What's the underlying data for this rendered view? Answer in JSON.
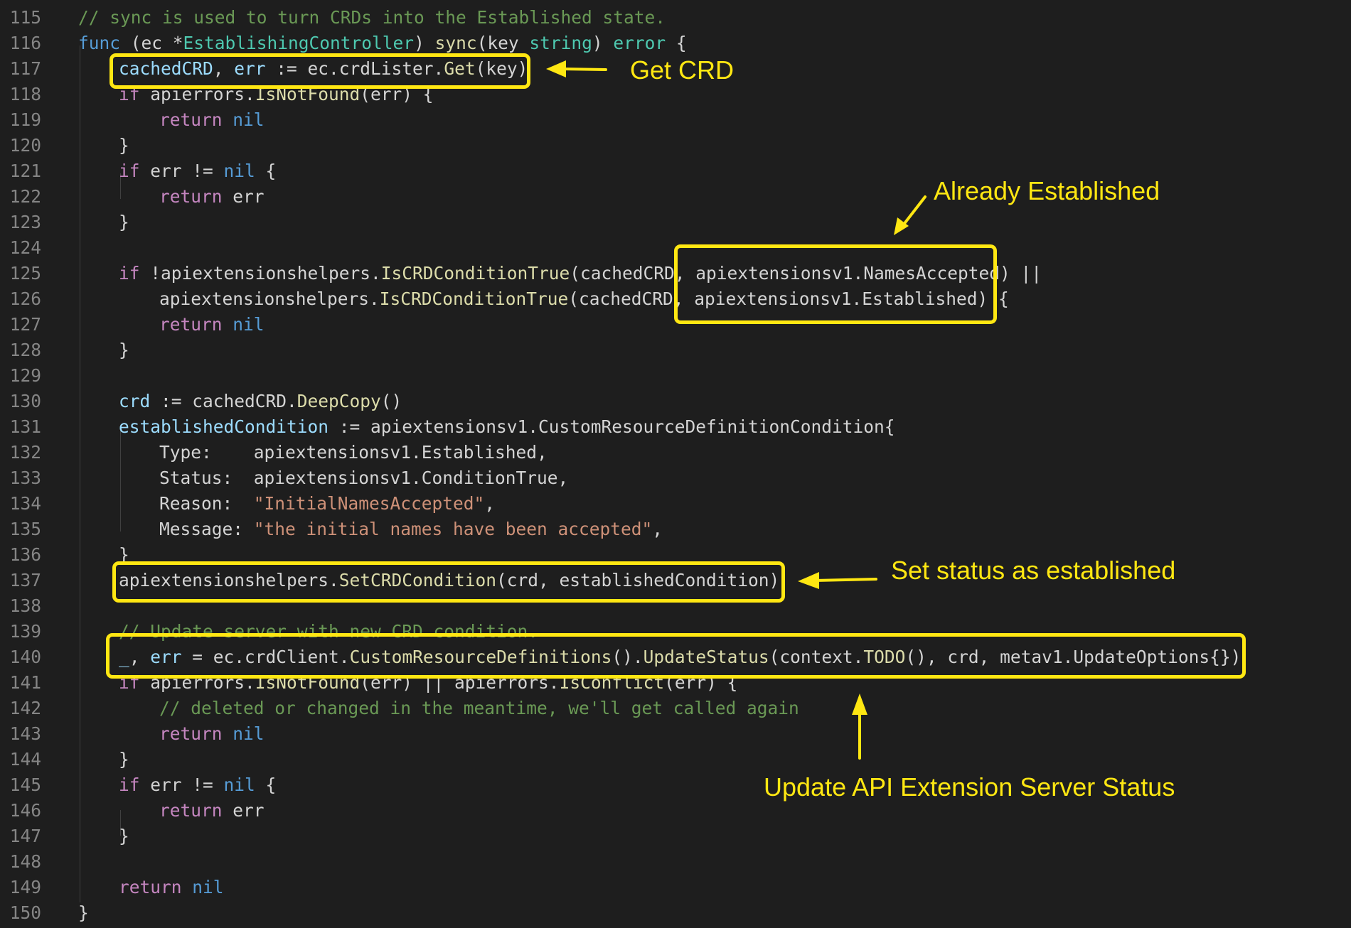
{
  "colors": {
    "background": "#1e1e1e",
    "line_number": "#858585",
    "highlight": "#ffe712",
    "comment": "#6a9955",
    "keyword": "#569cd6",
    "control": "#c586c0",
    "variable": "#9cdcfe",
    "function": "#dcdcaa",
    "type": "#4ec9b0",
    "string": "#ce9178",
    "text": "#d4d4d4"
  },
  "lines": [
    {
      "n": "115",
      "indent": 0,
      "tokens": [
        {
          "t": "// sync is used to turn CRDs into the Established state.",
          "k": "cmt"
        }
      ]
    },
    {
      "n": "116",
      "indent": 0,
      "tokens": [
        {
          "t": "func",
          "k": "kw"
        },
        {
          "t": " (ec ",
          "k": "plain"
        },
        {
          "t": "*",
          "k": "plain"
        },
        {
          "t": "EstablishingController",
          "k": "type"
        },
        {
          "t": ") ",
          "k": "plain"
        },
        {
          "t": "sync",
          "k": "fn"
        },
        {
          "t": "(key ",
          "k": "plain"
        },
        {
          "t": "string",
          "k": "type"
        },
        {
          "t": ") ",
          "k": "plain"
        },
        {
          "t": "error",
          "k": "type"
        },
        {
          "t": " {",
          "k": "plain"
        }
      ]
    },
    {
      "n": "117",
      "indent": 1,
      "tokens": [
        {
          "t": "cachedCRD",
          "k": "var"
        },
        {
          "t": ", ",
          "k": "plain"
        },
        {
          "t": "err",
          "k": "var"
        },
        {
          "t": " := ec.crdLister.",
          "k": "plain"
        },
        {
          "t": "Get",
          "k": "fn"
        },
        {
          "t": "(key)",
          "k": "plain"
        }
      ]
    },
    {
      "n": "118",
      "indent": 1,
      "tokens": [
        {
          "t": "if",
          "k": "ctl"
        },
        {
          "t": " apierrors.",
          "k": "plain"
        },
        {
          "t": "IsNotFound",
          "k": "fn"
        },
        {
          "t": "(err) {",
          "k": "plain"
        }
      ]
    },
    {
      "n": "119",
      "indent": 2,
      "tokens": [
        {
          "t": "return",
          "k": "ctl"
        },
        {
          "t": " ",
          "k": "plain"
        },
        {
          "t": "nil",
          "k": "kw"
        }
      ]
    },
    {
      "n": "120",
      "indent": 1,
      "tokens": [
        {
          "t": "}",
          "k": "plain"
        }
      ]
    },
    {
      "n": "121",
      "indent": 1,
      "tokens": [
        {
          "t": "if",
          "k": "ctl"
        },
        {
          "t": " err != ",
          "k": "plain"
        },
        {
          "t": "nil",
          "k": "kw"
        },
        {
          "t": " {",
          "k": "plain"
        }
      ]
    },
    {
      "n": "122",
      "indent": 2,
      "tokens": [
        {
          "t": "return",
          "k": "ctl"
        },
        {
          "t": " err",
          "k": "plain"
        }
      ]
    },
    {
      "n": "123",
      "indent": 1,
      "tokens": [
        {
          "t": "}",
          "k": "plain"
        }
      ]
    },
    {
      "n": "124",
      "indent": 0,
      "tokens": []
    },
    {
      "n": "125",
      "indent": 1,
      "tokens": [
        {
          "t": "if",
          "k": "ctl"
        },
        {
          "t": " !apiextensionshelpers.",
          "k": "plain"
        },
        {
          "t": "IsCRDConditionTrue",
          "k": "fn"
        },
        {
          "t": "(cachedCRD, apiextensionsv1.NamesAccepted) ||",
          "k": "plain"
        }
      ]
    },
    {
      "n": "126",
      "indent": 2,
      "tokens": [
        {
          "t": "apiextensionshelpers.",
          "k": "plain"
        },
        {
          "t": "IsCRDConditionTrue",
          "k": "fn"
        },
        {
          "t": "(cachedCRD, apiextensionsv1.Established) {",
          "k": "plain"
        }
      ]
    },
    {
      "n": "127",
      "indent": 2,
      "tokens": [
        {
          "t": "return",
          "k": "ctl"
        },
        {
          "t": " ",
          "k": "plain"
        },
        {
          "t": "nil",
          "k": "kw"
        }
      ]
    },
    {
      "n": "128",
      "indent": 1,
      "tokens": [
        {
          "t": "}",
          "k": "plain"
        }
      ]
    },
    {
      "n": "129",
      "indent": 0,
      "tokens": []
    },
    {
      "n": "130",
      "indent": 1,
      "tokens": [
        {
          "t": "crd",
          "k": "var"
        },
        {
          "t": " := cachedCRD.",
          "k": "plain"
        },
        {
          "t": "DeepCopy",
          "k": "fn"
        },
        {
          "t": "()",
          "k": "plain"
        }
      ]
    },
    {
      "n": "131",
      "indent": 1,
      "tokens": [
        {
          "t": "establishedCondition",
          "k": "var"
        },
        {
          "t": " := apiextensionsv1.CustomResourceDefinitionCondition{",
          "k": "plain"
        }
      ]
    },
    {
      "n": "132",
      "indent": 2,
      "tokens": [
        {
          "t": "Type:    apiextensionsv1.Established,",
          "k": "plain"
        }
      ]
    },
    {
      "n": "133",
      "indent": 2,
      "tokens": [
        {
          "t": "Status:  apiextensionsv1.ConditionTrue,",
          "k": "plain"
        }
      ]
    },
    {
      "n": "134",
      "indent": 2,
      "tokens": [
        {
          "t": "Reason:  ",
          "k": "plain"
        },
        {
          "t": "\"InitialNamesAccepted\"",
          "k": "str"
        },
        {
          "t": ",",
          "k": "plain"
        }
      ]
    },
    {
      "n": "135",
      "indent": 2,
      "tokens": [
        {
          "t": "Message: ",
          "k": "plain"
        },
        {
          "t": "\"the initial names have been accepted\"",
          "k": "str"
        },
        {
          "t": ",",
          "k": "plain"
        }
      ]
    },
    {
      "n": "136",
      "indent": 1,
      "tokens": [
        {
          "t": "}",
          "k": "plain"
        }
      ]
    },
    {
      "n": "137",
      "indent": 1,
      "tokens": [
        {
          "t": "apiextensionshelpers.",
          "k": "plain"
        },
        {
          "t": "SetCRDCondition",
          "k": "fn"
        },
        {
          "t": "(crd, establishedCondition)",
          "k": "plain"
        }
      ]
    },
    {
      "n": "138",
      "indent": 0,
      "tokens": []
    },
    {
      "n": "139",
      "indent": 1,
      "tokens": [
        {
          "t": "// Update server with new CRD condition.",
          "k": "cmt"
        }
      ]
    },
    {
      "n": "140",
      "indent": 1,
      "tokens": [
        {
          "t": "_",
          "k": "var"
        },
        {
          "t": ", ",
          "k": "plain"
        },
        {
          "t": "err",
          "k": "var"
        },
        {
          "t": " = ec.crdClient.",
          "k": "plain"
        },
        {
          "t": "CustomResourceDefinitions",
          "k": "fn"
        },
        {
          "t": "().",
          "k": "plain"
        },
        {
          "t": "UpdateStatus",
          "k": "fn"
        },
        {
          "t": "(context.",
          "k": "plain"
        },
        {
          "t": "TODO",
          "k": "fn"
        },
        {
          "t": "(), crd, metav1.UpdateOptions{})",
          "k": "plain"
        }
      ]
    },
    {
      "n": "141",
      "indent": 1,
      "tokens": [
        {
          "t": "if",
          "k": "ctl"
        },
        {
          "t": " apierrors.",
          "k": "plain"
        },
        {
          "t": "IsNotFound",
          "k": "fn"
        },
        {
          "t": "(err) || apierrors.",
          "k": "plain"
        },
        {
          "t": "IsConflict",
          "k": "fn"
        },
        {
          "t": "(err) {",
          "k": "plain"
        }
      ]
    },
    {
      "n": "142",
      "indent": 2,
      "tokens": [
        {
          "t": "// deleted or changed in the meantime, we'll get called again",
          "k": "cmt"
        }
      ]
    },
    {
      "n": "143",
      "indent": 2,
      "tokens": [
        {
          "t": "return",
          "k": "ctl"
        },
        {
          "t": " ",
          "k": "plain"
        },
        {
          "t": "nil",
          "k": "kw"
        }
      ]
    },
    {
      "n": "144",
      "indent": 1,
      "tokens": [
        {
          "t": "}",
          "k": "plain"
        }
      ]
    },
    {
      "n": "145",
      "indent": 1,
      "tokens": [
        {
          "t": "if",
          "k": "ctl"
        },
        {
          "t": " err != ",
          "k": "plain"
        },
        {
          "t": "nil",
          "k": "kw"
        },
        {
          "t": " {",
          "k": "plain"
        }
      ]
    },
    {
      "n": "146",
      "indent": 2,
      "tokens": [
        {
          "t": "return",
          "k": "ctl"
        },
        {
          "t": " err",
          "k": "plain"
        }
      ]
    },
    {
      "n": "147",
      "indent": 1,
      "tokens": [
        {
          "t": "}",
          "k": "plain"
        }
      ]
    },
    {
      "n": "148",
      "indent": 0,
      "tokens": []
    },
    {
      "n": "149",
      "indent": 1,
      "tokens": [
        {
          "t": "return",
          "k": "ctl"
        },
        {
          "t": " ",
          "k": "plain"
        },
        {
          "t": "nil",
          "k": "kw"
        }
      ]
    },
    {
      "n": "150",
      "indent": 0,
      "tokens": [
        {
          "t": "}",
          "k": "plain"
        }
      ]
    }
  ],
  "annotations": {
    "get_crd": "Get CRD",
    "already_established": "Already Established",
    "set_status": "Set status as established",
    "update_status": "Update API Extension Server Status"
  }
}
